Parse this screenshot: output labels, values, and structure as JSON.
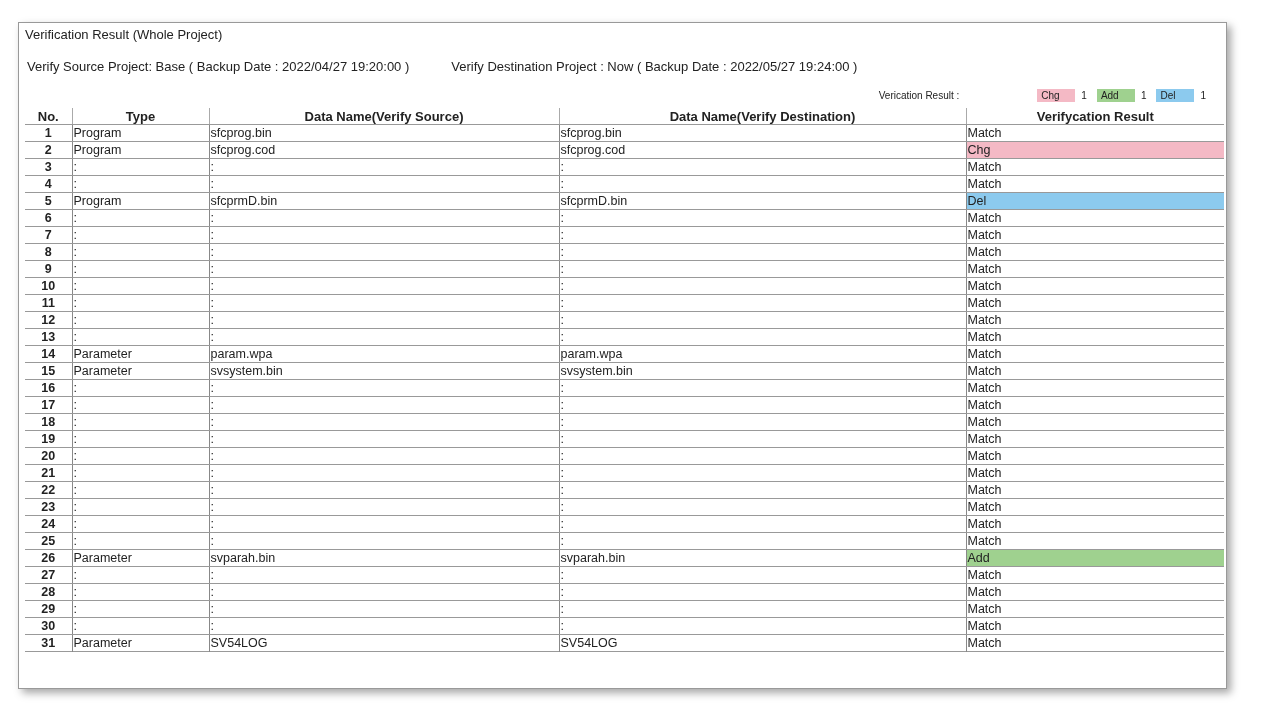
{
  "title": "Verification Result (Whole Project)",
  "source_project": "Verify Source Project: Base ( Backup Date : 2022/04/27 19:20:00 )",
  "destination_project": "Verify Destination Project : Now ( Backup Date : 2022/05/27 19:24:00 )",
  "legend": {
    "label": "Verication Result :",
    "items": [
      {
        "name": "Chg",
        "count": "1",
        "color": "#f4b9c5"
      },
      {
        "name": "Add",
        "count": "1",
        "color": "#9fd18f"
      },
      {
        "name": "Del",
        "count": "1",
        "color": "#8ccaee"
      }
    ]
  },
  "table": {
    "columns": [
      "No.",
      "Type",
      "Data Name(Verify Source)",
      "Data Name(Verify Destination)",
      "Verifycation Result"
    ],
    "rows": [
      {
        "no": "1",
        "type": "Program",
        "source": "sfcprog.bin",
        "destination": "sfcprog.bin",
        "result": "Match"
      },
      {
        "no": "2",
        "type": "Program",
        "source": "sfcprog.cod",
        "destination": "sfcprog.cod",
        "result": "Chg",
        "color": "#f4b9c5"
      },
      {
        "no": "3",
        "type": ":",
        "source": ":",
        "destination": ":",
        "result": "Match"
      },
      {
        "no": "4",
        "type": ":",
        "source": ":",
        "destination": ":",
        "result": "Match"
      },
      {
        "no": "5",
        "type": "Program",
        "source": "sfcprmD.bin",
        "destination": "sfcprmD.bin",
        "result": "Del",
        "color": "#8ccaee"
      },
      {
        "no": "6",
        "type": ":",
        "source": ":",
        "destination": ":",
        "result": "Match"
      },
      {
        "no": "7",
        "type": ":",
        "source": ":",
        "destination": ":",
        "result": "Match"
      },
      {
        "no": "8",
        "type": ":",
        "source": ":",
        "destination": ":",
        "result": "Match"
      },
      {
        "no": "9",
        "type": ":",
        "source": ":",
        "destination": ":",
        "result": "Match"
      },
      {
        "no": "10",
        "type": ":",
        "source": ":",
        "destination": ":",
        "result": "Match"
      },
      {
        "no": "11",
        "type": ":",
        "source": ":",
        "destination": ":",
        "result": "Match"
      },
      {
        "no": "12",
        "type": ":",
        "source": ":",
        "destination": ":",
        "result": "Match"
      },
      {
        "no": "13",
        "type": ":",
        "source": ":",
        "destination": ":",
        "result": "Match"
      },
      {
        "no": "14",
        "type": "Parameter",
        "source": "param.wpa",
        "destination": "param.wpa",
        "result": "Match"
      },
      {
        "no": "15",
        "type": "Parameter",
        "source": "svsystem.bin",
        "destination": "svsystem.bin",
        "result": "Match"
      },
      {
        "no": "16",
        "type": ":",
        "source": ":",
        "destination": ":",
        "result": "Match"
      },
      {
        "no": "17",
        "type": ":",
        "source": ":",
        "destination": ":",
        "result": "Match"
      },
      {
        "no": "18",
        "type": ":",
        "source": ":",
        "destination": ":",
        "result": "Match"
      },
      {
        "no": "19",
        "type": ":",
        "source": ":",
        "destination": ":",
        "result": "Match"
      },
      {
        "no": "20",
        "type": ":",
        "source": ":",
        "destination": ":",
        "result": "Match"
      },
      {
        "no": "21",
        "type": ":",
        "source": ":",
        "destination": ":",
        "result": "Match"
      },
      {
        "no": "22",
        "type": ":",
        "source": ":",
        "destination": ":",
        "result": "Match"
      },
      {
        "no": "23",
        "type": ":",
        "source": ":",
        "destination": ":",
        "result": "Match"
      },
      {
        "no": "24",
        "type": ":",
        "source": ":",
        "destination": ":",
        "result": "Match"
      },
      {
        "no": "25",
        "type": ":",
        "source": ":",
        "destination": ":",
        "result": "Match"
      },
      {
        "no": "26",
        "type": "Parameter",
        "source": "svparah.bin",
        "destination": "svparah.bin",
        "result": "Add",
        "color": "#9fd18f"
      },
      {
        "no": "27",
        "type": ":",
        "source": ":",
        "destination": ":",
        "result": "Match"
      },
      {
        "no": "28",
        "type": ":",
        "source": ":",
        "destination": ":",
        "result": "Match"
      },
      {
        "no": "29",
        "type": ":",
        "source": ":",
        "destination": ":",
        "result": "Match"
      },
      {
        "no": "30",
        "type": ":",
        "source": ":",
        "destination": ":",
        "result": "Match"
      },
      {
        "no": "31",
        "type": "Parameter",
        "source": "SV54LOG",
        "destination": "SV54LOG",
        "result": "Match"
      }
    ]
  }
}
